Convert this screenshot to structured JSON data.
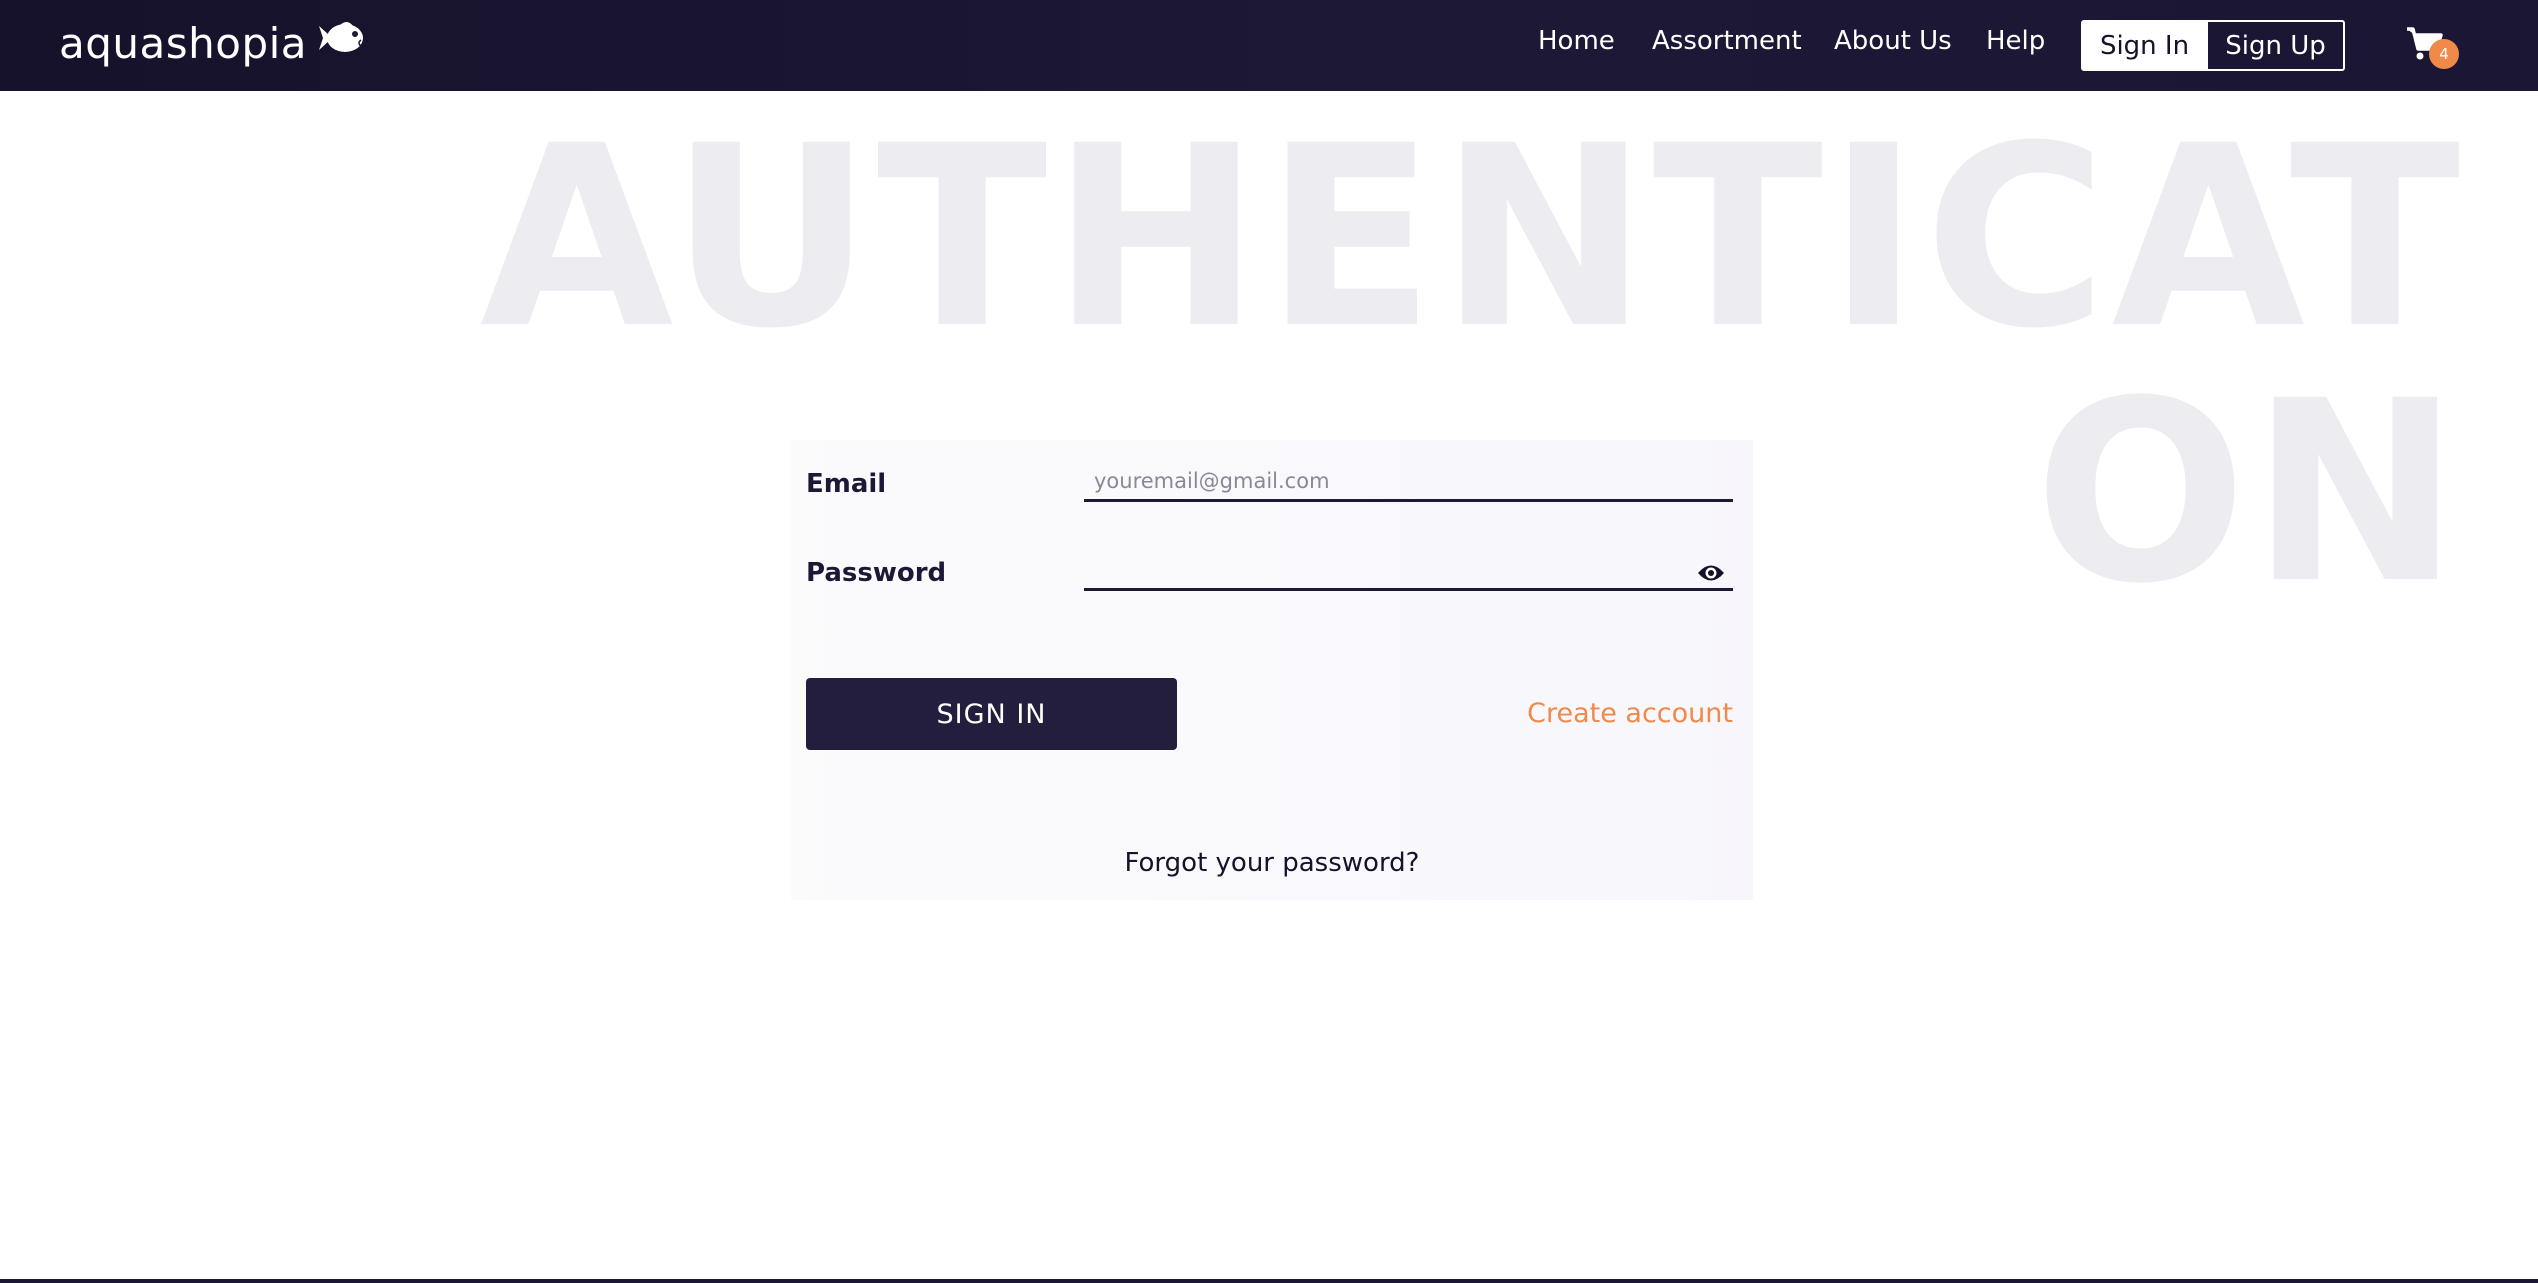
{
  "header": {
    "logo_text": "aquashopia",
    "logo_icon": "fish-icon",
    "nav": [
      "Home",
      "Assortment",
      "About Us",
      "Help"
    ],
    "sign_in_label": "Sign In",
    "sign_up_label": "Sign Up",
    "cart_icon": "cart-icon",
    "cart_count": "4"
  },
  "watermark": {
    "line1": "AUTHENTICATI",
    "line2": "ON"
  },
  "form": {
    "email_label": "Email",
    "email_placeholder": "youremail@gmail.com",
    "email_value": "",
    "password_label": "Password",
    "password_value": "",
    "password_toggle_icon": "eye-icon",
    "submit_label": "SIGN IN",
    "create_account_label": "Create account",
    "forgot_label": "Forgot your password?"
  },
  "colors": {
    "header_bg": "#16122b",
    "accent": "#f08a4b",
    "button_bg": "#231e3d",
    "watermark": "#ececf1"
  }
}
